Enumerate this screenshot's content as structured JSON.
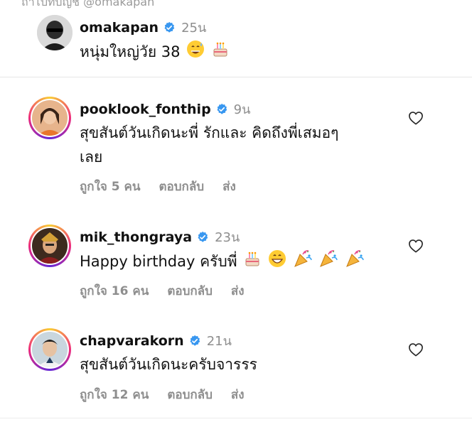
{
  "top_hint": "ถ้าไปที่บัญชี @omakapan",
  "caption": {
    "username": "omakapan",
    "time": "25น",
    "text": "หนุ่มใหญ่วัย 38",
    "emojis": [
      "sweat-smile-emoji",
      "birthday-cake-emoji"
    ]
  },
  "comments": [
    {
      "username": "pooklook_fonthip",
      "time": "9น",
      "text_line1": "สุขสันต์วันเกิดนะพี่ รักและ คิดถึงพี่เสมอๆ",
      "text_line2": "เลย",
      "likes": "ถูกใจ 5 คน",
      "reply": "ตอบกลับ",
      "send": "ส่ง"
    },
    {
      "username": "mik_thongraya",
      "time": "23น",
      "text": "Happy birthday ครับพี่",
      "emojis": [
        "birthday-cake-emoji",
        "grin-emoji",
        "party-popper-emoji",
        "party-popper-emoji",
        "party-popper-emoji"
      ],
      "likes": "ถูกใจ 16 คน",
      "reply": "ตอบกลับ",
      "send": "ส่ง"
    },
    {
      "username": "chapvarakorn",
      "time": "21น",
      "text": "สุขสันต์วันเกิดนะครับจารรร",
      "likes": "ถูกใจ 12 คน",
      "reply": "ตอบกลับ",
      "send": "ส่ง"
    }
  ],
  "colors": {
    "verified_blue": "#3897f0",
    "muted_text": "#8e8e8e"
  }
}
